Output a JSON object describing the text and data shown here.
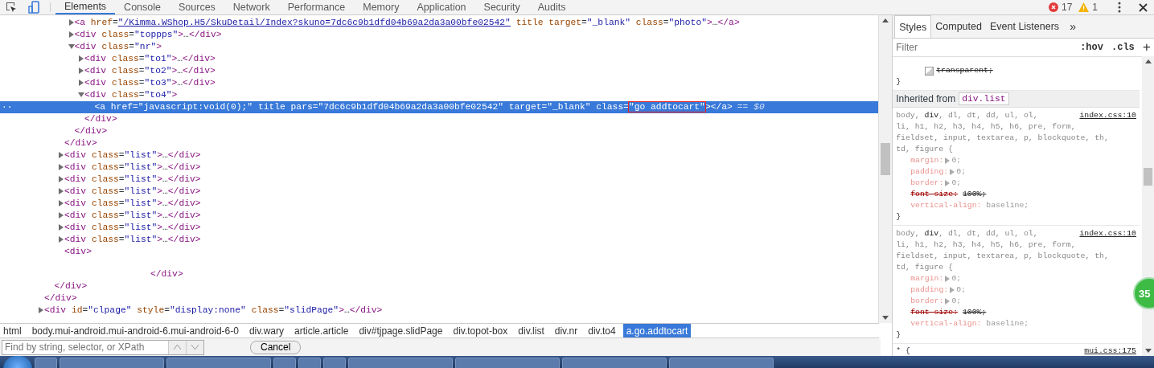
{
  "toolbar": {
    "tabs": [
      {
        "label": "Elements",
        "selected": true
      },
      {
        "label": "Console",
        "selected": false
      },
      {
        "label": "Sources",
        "selected": false
      },
      {
        "label": "Network",
        "selected": false
      },
      {
        "label": "Performance",
        "selected": false
      },
      {
        "label": "Memory",
        "selected": false
      },
      {
        "label": "Application",
        "selected": false
      },
      {
        "label": "Security",
        "selected": false
      },
      {
        "label": "Audits",
        "selected": false
      }
    ],
    "errors": "17",
    "warnings": "1"
  },
  "dom_tree": [
    {
      "close": "</div>",
      "children": [
        {
          "close": "</div>",
          "children": [
            {
              "close": "</div>",
              "children": [
                {
                  "open": "<a href=\"/Kimma.WShop.H5/SkuDetail/Index?skuno=7dc6c9b1dfd04b69a2da3a00bfe02542\" title target=\"_blank\" class=\"photo\">…</a>",
                  "expanded": false,
                  "href_link": true
                },
                {
                  "open": "<div class=\"toppps\">…</div>",
                  "expanded": false
                },
                {
                  "open": "<div class=\"nr\">",
                  "expanded": true,
                  "close": "</div>",
                  "children": [
                    {
                      "open": "<div class=\"to1\">…</div>",
                      "expanded": false
                    },
                    {
                      "open": "<div class=\"to2\">…</div>",
                      "expanded": false
                    },
                    {
                      "open": "<div class=\"to3\">…</div>",
                      "expanded": false
                    },
                    {
                      "open": "<div class=\"to4\">",
                      "expanded": true,
                      "close": "</div>",
                      "children": [
                        {
                          "open": "<a href=\"javascript:void(0);\" title pars=\"7dc6c9b1dfd04b69a2da3a00bfe02542\" target=\"_blank\" class=\"go addtocart\"></a>",
                          "suffix": "== $0",
                          "marker": "··",
                          "selected": true,
                          "annotated": true
                        }
                      ]
                    }
                  ]
                }
              ]
            },
            {
              "open": "<div class=\"list\">…</div>",
              "expanded": false
            },
            {
              "open": "<div class=\"list\">…</div>",
              "expanded": false
            },
            {
              "open": "<div class=\"list\">…</div>",
              "expanded": false
            },
            {
              "open": "<div class=\"list\">…</div>",
              "expanded": false
            },
            {
              "open": "<div class=\"list\">…</div>",
              "expanded": false
            },
            {
              "open": "<div class=\"list\">…</div>",
              "expanded": false
            },
            {
              "open": "<div class=\"list\">…</div>",
              "expanded": false
            },
            {
              "open": "<div class=\"list\">…</div>",
              "expanded": false
            },
            {
              "open": "<div>",
              "close": "</div>",
              "whitespace": true
            }
          ]
        }
      ]
    },
    {
      "open": "<div id=\"clpage\" style=\"display:none\" class=\"slidPage\">…</div>",
      "expanded": false
    }
  ],
  "breadcrumbs": [
    {
      "label": "html",
      "selected": false
    },
    {
      "label": "body.mui-android.mui-android-6.mui-android-6-0",
      "selected": false
    },
    {
      "label": "div.wary",
      "selected": false
    },
    {
      "label": "article.article",
      "selected": false
    },
    {
      "label": "div#tjpage.slidPage",
      "selected": false
    },
    {
      "label": "div.topot-box",
      "selected": false
    },
    {
      "label": "div.list",
      "selected": false
    },
    {
      "label": "div.nr",
      "selected": false
    },
    {
      "label": "div.to4",
      "selected": false
    },
    {
      "label": "a.go.addtocart",
      "selected": true
    }
  ],
  "search": {
    "placeholder": "Find by string, selector, or XPath",
    "cancel": "Cancel"
  },
  "styles_pane": {
    "tabs": [
      {
        "label": "Styles",
        "selected": true
      },
      {
        "label": "Computed",
        "selected": false
      },
      {
        "label": "Event Listeners",
        "selected": false
      }
    ],
    "more": "»",
    "filter_placeholder": "Filter",
    "hov": ":hov",
    "cls": ".cls",
    "add": "+",
    "top_rule": {
      "value": "transparent;",
      "struck": true,
      "close": "}"
    },
    "inherited_label": "Inherited from",
    "inherited_source": "div.list",
    "rules": [
      {
        "selector_lines": [
          [
            {
              "text": "body, ",
              "matched": false
            },
            {
              "text": "div",
              "matched": true
            },
            {
              "text": ", dl, dt, dd, ul, ol,",
              "matched": false
            }
          ],
          [
            {
              "text": "li, h1, h2, h3, h4, h5, h6, pre, form,",
              "matched": false
            }
          ],
          [
            {
              "text": "fieldset, input, textarea, p, blockquote, th,",
              "matched": false
            }
          ],
          [
            {
              "text": "td, figure",
              "matched": false
            }
          ]
        ],
        "open": "{",
        "source": "index.css:10",
        "close": "}",
        "properties": [
          {
            "name": "margin:",
            "value": "0;",
            "expandable": true,
            "struck": false
          },
          {
            "name": "padding:",
            "value": "0;",
            "expandable": true,
            "struck": false
          },
          {
            "name": "border:",
            "value": "0;",
            "expandable": true,
            "struck": false
          },
          {
            "name": "font-size:",
            "value": "100%;",
            "expandable": false,
            "struck": true
          },
          {
            "name": "vertical-align:",
            "value": "baseline;",
            "expandable": false,
            "struck": false
          }
        ]
      },
      {
        "selector_lines": [
          [
            {
              "text": "body, ",
              "matched": false
            },
            {
              "text": "div",
              "matched": true
            },
            {
              "text": ", dl, dt, dd, ul, ol,",
              "matched": false
            }
          ],
          [
            {
              "text": "li, h1, h2, h3, h4, h5, h6, pre, form,",
              "matched": false
            }
          ],
          [
            {
              "text": "fieldset, input, textarea, p, blockquote, th,",
              "matched": false
            }
          ],
          [
            {
              "text": "td, figure",
              "matched": false
            }
          ]
        ],
        "open": "{",
        "source": "index.css:10",
        "close": "}",
        "properties": [
          {
            "name": "margin:",
            "value": "0;",
            "expandable": true,
            "struck": false
          },
          {
            "name": "padding:",
            "value": "0;",
            "expandable": true,
            "struck": false
          },
          {
            "name": "border:",
            "value": "0;",
            "expandable": true,
            "struck": false
          },
          {
            "name": "font-size:",
            "value": "100%;",
            "expandable": false,
            "struck": true
          },
          {
            "name": "vertical-align:",
            "value": "baseline;",
            "expandable": false,
            "struck": false
          }
        ]
      }
    ],
    "last_rule": {
      "selector": "* {",
      "source": "mui.css:175"
    }
  },
  "floating_badge": "35",
  "taskbar": {
    "items": [
      {
        "kind": "app"
      },
      {
        "kind": "window"
      },
      {
        "kind": "window"
      },
      {
        "kind": "app"
      },
      {
        "kind": "app"
      },
      {
        "kind": "app"
      },
      {
        "kind": "window"
      },
      {
        "kind": "window"
      },
      {
        "kind": "window"
      },
      {
        "kind": "window"
      }
    ]
  }
}
